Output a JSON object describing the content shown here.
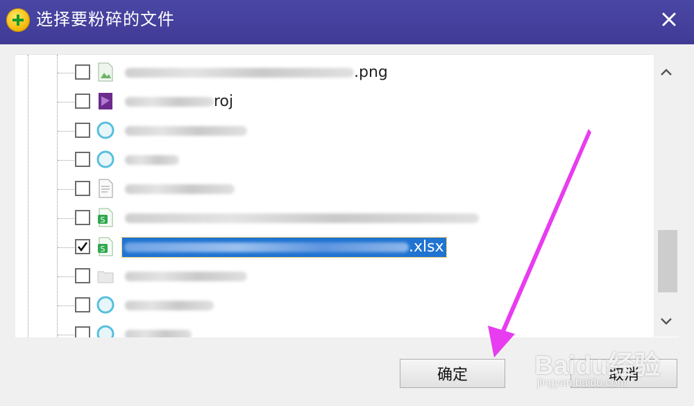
{
  "dialog": {
    "title": "选择要粉碎的文件",
    "icons": {
      "app": "add-circle-icon",
      "close": "close-icon"
    }
  },
  "file_list": {
    "rows": [
      {
        "suffix": ".png",
        "checked": false,
        "icon": "image-file-icon"
      },
      {
        "suffix": "roj",
        "checked": false,
        "icon": "project-file-icon"
      },
      {
        "suffix": "",
        "checked": false,
        "icon": "browser-shortcut-icon"
      },
      {
        "suffix": "",
        "checked": false,
        "icon": "browser-shortcut-icon"
      },
      {
        "suffix": "",
        "checked": false,
        "icon": "text-file-icon"
      },
      {
        "suffix": "",
        "checked": false,
        "icon": "spreadsheet-file-icon"
      },
      {
        "suffix": ".xlsx",
        "checked": true,
        "selected": true,
        "icon": "spreadsheet-file-icon"
      },
      {
        "suffix": "",
        "checked": false,
        "icon": "folder-icon"
      },
      {
        "suffix": "",
        "checked": false,
        "icon": "browser-shortcut-icon"
      },
      {
        "suffix": "",
        "checked": false,
        "icon": "browser-shortcut-icon"
      }
    ]
  },
  "buttons": {
    "ok_label": "确定",
    "cancel_label": "取消"
  },
  "watermark": {
    "logo": "Baidu经验",
    "url": "jingyan.baidu.com"
  },
  "colors": {
    "titlebar": "#4a46a4",
    "selection": "#1f73d1",
    "annotation_arrow": "#e83cf0"
  }
}
